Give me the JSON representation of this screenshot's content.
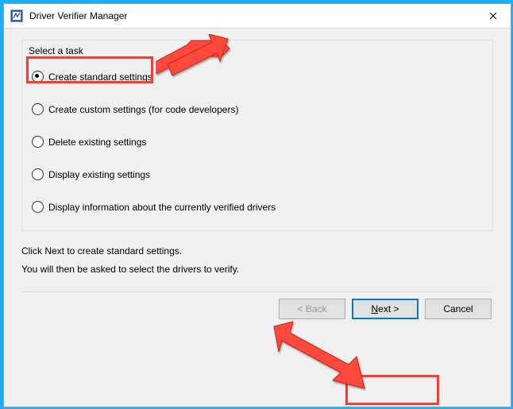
{
  "window": {
    "title": "Driver Verifier Manager"
  },
  "task": {
    "group_label": "Select a task",
    "options": [
      "Create standard settings",
      "Create custom settings (for code developers)",
      "Delete existing settings",
      "Display existing settings",
      "Display information about the currently verified drivers"
    ],
    "selected_index": 0
  },
  "info": {
    "line1": "Click Next to create standard settings.",
    "line2": "You will then be asked to select the drivers to verify."
  },
  "buttons": {
    "back": "< Back",
    "next": "Next >",
    "cancel": "Cancel"
  },
  "icons": {
    "app": "verifier-app-icon",
    "close": "close-icon"
  },
  "annotations": {
    "highlight_color": "#ff3b30",
    "arrows": 2
  }
}
